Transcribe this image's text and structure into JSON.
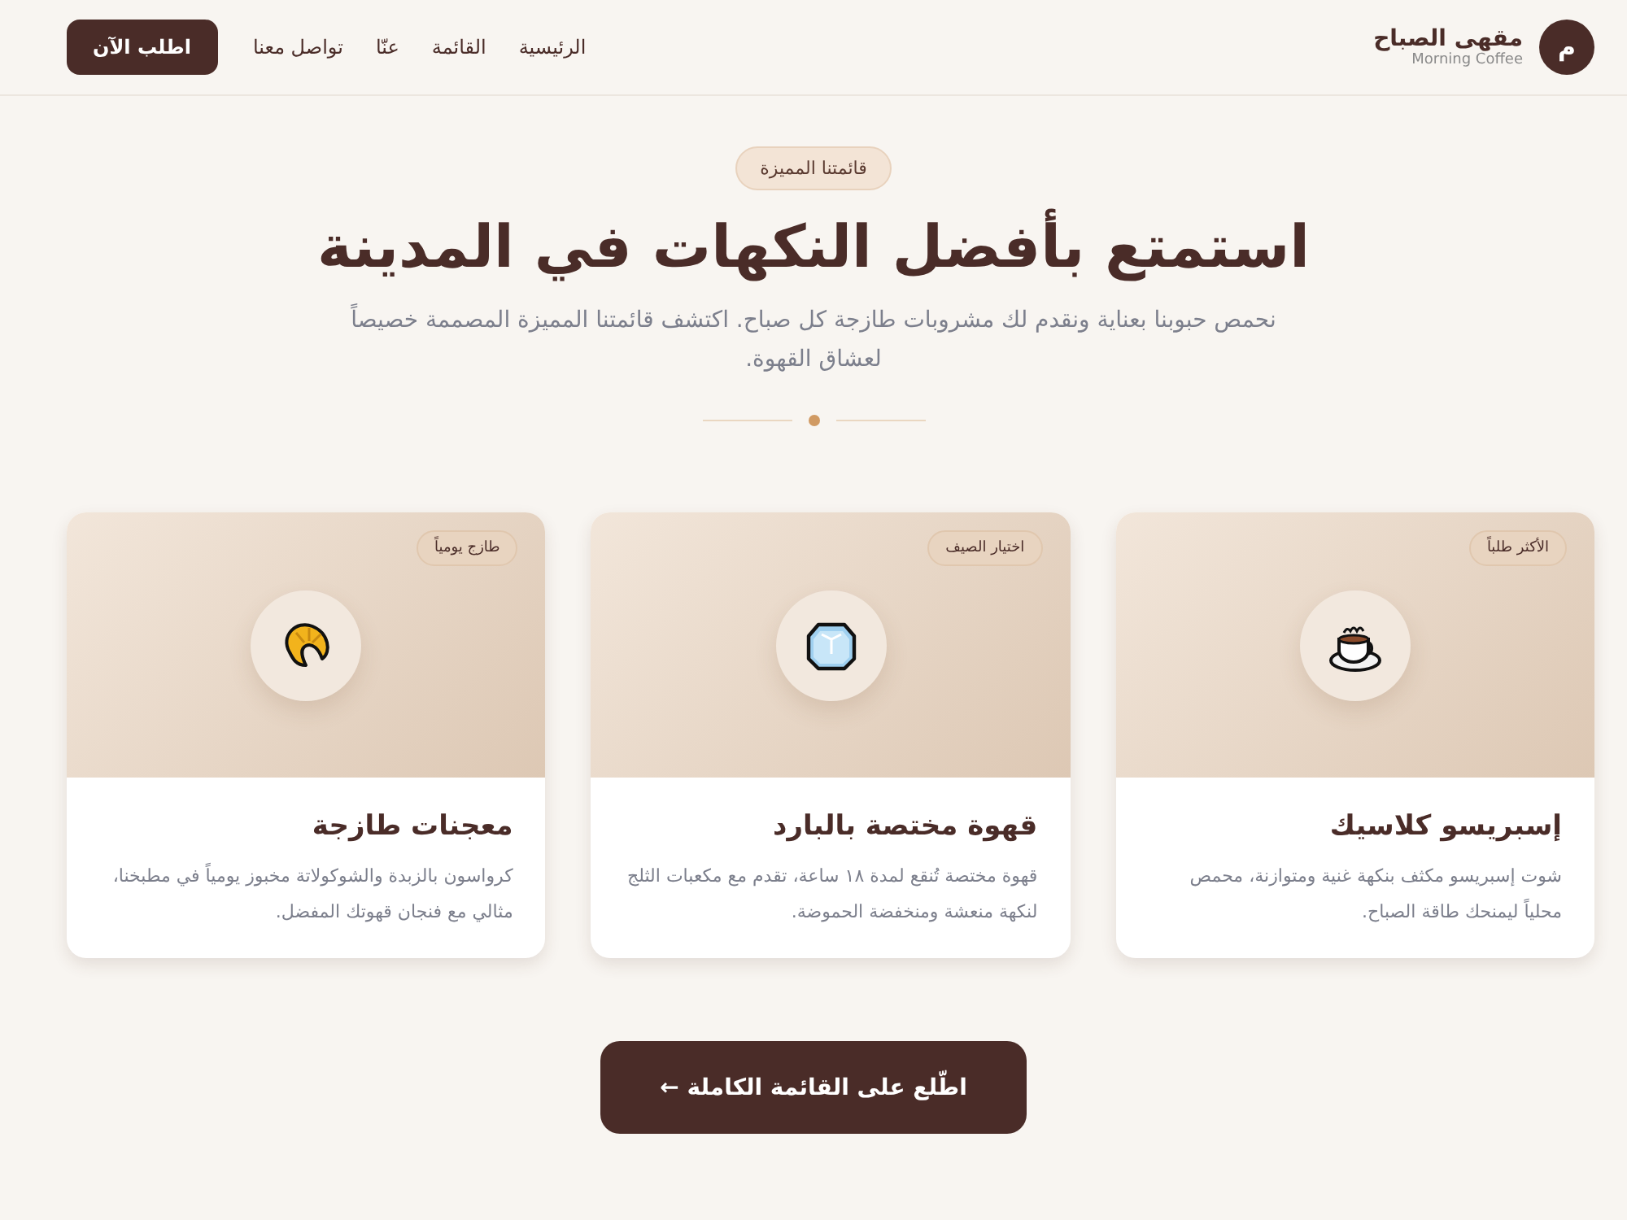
{
  "header": {
    "logo_letter": "م",
    "brand_name": "مقهى الصباح",
    "brand_subtitle": "Morning Coffee",
    "nav": [
      {
        "label": "الرئيسية"
      },
      {
        "label": "القائمة"
      },
      {
        "label": "عنّا"
      },
      {
        "label": "تواصل معنا"
      }
    ],
    "cta": "اطلب الآن"
  },
  "hero": {
    "badge": "قائمتنا المميزة",
    "title": "استمتع بأفضل النكهات في المدينة",
    "subtitle": "نحمص حبوبنا بعناية ونقدم لك مشروبات طازجة كل صباح. اكتشف قائمتنا المميزة المصممة خصيصاً لعشاق القهوة."
  },
  "cards": [
    {
      "kind": "cup",
      "tag": "الأكثر طلباً",
      "title": "إسبريسو كلاسيك",
      "description": "شوت إسبريسو مكثف بنكهة غنية ومتوازنة، محمص محلياً ليمنحك طاقة الصباح."
    },
    {
      "kind": "ice",
      "tag": "اختيار الصيف",
      "title": "قهوة مختصة بالبارد",
      "description": "قهوة مختصة تُنقع لمدة ١٨ ساعة، تقدم مع مكعبات الثلج لنكهة منعشة ومنخفضة الحموضة."
    },
    {
      "kind": "croissant",
      "tag": "طازج يومياً",
      "title": "معجنات طازجة",
      "description": "كرواسون بالزبدة والشوكولاتة مخبوز يومياً في مطبخنا، مثالي مع فنجان قهوتك المفضل."
    }
  ],
  "footer_button": "اطّلع على القائمة الكاملة ←"
}
